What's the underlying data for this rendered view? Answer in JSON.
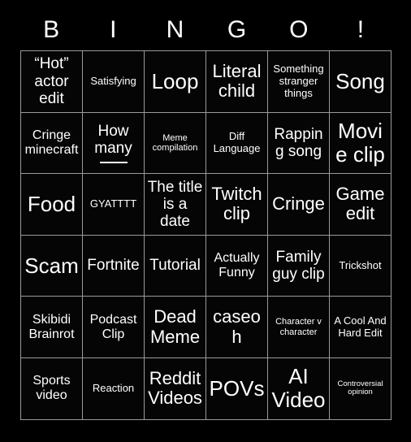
{
  "card": {
    "header_letters": [
      "B",
      "I",
      "N",
      "G",
      "O",
      "!"
    ],
    "background_color": "#000000",
    "text_color": "#ffffff",
    "grid_line_color": "#9a9a9a",
    "rows": 6,
    "columns": 6,
    "cells": [
      [
        {
          "text": "“Hot” actor edit",
          "size": "s-lg"
        },
        {
          "text": "Satisfying",
          "size": "s-sm"
        },
        {
          "text": "Loop",
          "size": "s-xxl"
        },
        {
          "text": "Literal child",
          "size": "s-xl"
        },
        {
          "text": "Something stranger things",
          "size": "s-sm"
        },
        {
          "text": "Song",
          "size": "s-xxl"
        }
      ],
      [
        {
          "text": "Cringe minecraft",
          "size": "s-md"
        },
        {
          "text": "How many",
          "size": "s-lg",
          "blank_line": true
        },
        {
          "text": "Meme compilation",
          "size": "s-xs"
        },
        {
          "text": "Diff Language",
          "size": "s-sm"
        },
        {
          "text": "Rapping song",
          "size": "s-lg"
        },
        {
          "text": "Movie clip",
          "size": "s-xxl"
        }
      ],
      [
        {
          "text": "Food",
          "size": "s-xxl"
        },
        {
          "text": "GYATTTT",
          "size": "s-sm"
        },
        {
          "text": "The title is a date",
          "size": "s-lg"
        },
        {
          "text": "Twitch clip",
          "size": "s-xl"
        },
        {
          "text": "Cringe",
          "size": "s-xl"
        },
        {
          "text": "Game edit",
          "size": "s-xl"
        }
      ],
      [
        {
          "text": "Scam",
          "size": "s-xxl"
        },
        {
          "text": "Fortnite",
          "size": "s-lg"
        },
        {
          "text": "Tutorial",
          "size": "s-lg"
        },
        {
          "text": "Actually Funny",
          "size": "s-md"
        },
        {
          "text": "Family guy clip",
          "size": "s-lg"
        },
        {
          "text": "Trickshot",
          "size": "s-sm"
        }
      ],
      [
        {
          "text": "Skibidi Brainrot",
          "size": "s-md"
        },
        {
          "text": "Podcast Clip",
          "size": "s-md"
        },
        {
          "text": "Dead Meme",
          "size": "s-xl"
        },
        {
          "text": "caseoh",
          "size": "s-xl"
        },
        {
          "text": "Character v character",
          "size": "s-xs"
        },
        {
          "text": "A Cool And Hard Edit",
          "size": "s-sm"
        }
      ],
      [
        {
          "text": "Sports video",
          "size": "s-md"
        },
        {
          "text": "Reaction",
          "size": "s-sm"
        },
        {
          "text": "Reddit Videos",
          "size": "s-xl"
        },
        {
          "text": "POVs",
          "size": "s-xxl"
        },
        {
          "text": "AI Video",
          "size": "s-xxl"
        },
        {
          "text": "Controversial opinion",
          "size": "s-xxs"
        }
      ]
    ]
  }
}
